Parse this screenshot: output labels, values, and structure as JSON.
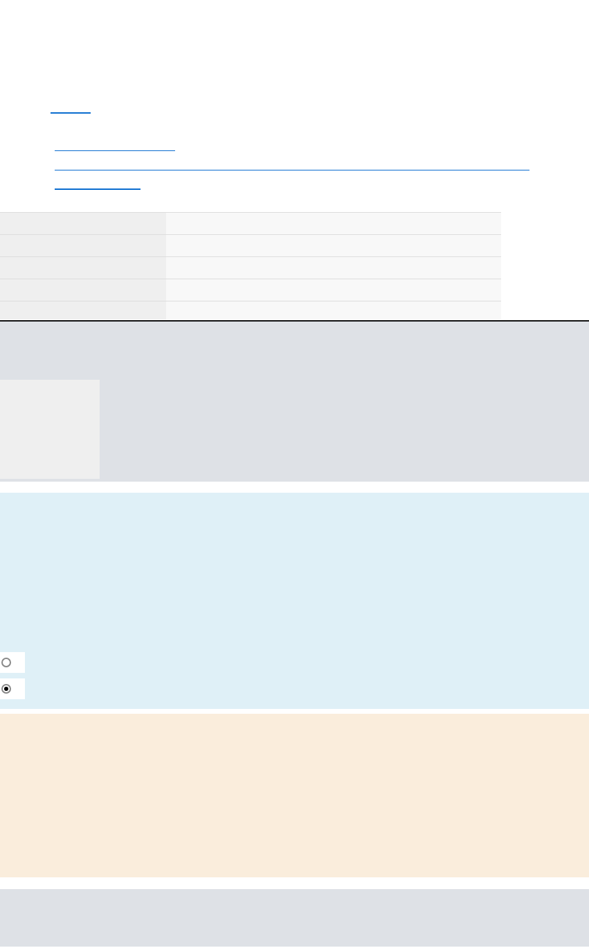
{
  "table": {
    "rows": [
      {
        "kind": "row"
      },
      {
        "kind": "row"
      },
      {
        "kind": "row"
      },
      {
        "kind": "row"
      },
      {
        "kind": "row"
      }
    ]
  },
  "radios": [
    {
      "selected": false
    },
    {
      "selected": true
    }
  ]
}
